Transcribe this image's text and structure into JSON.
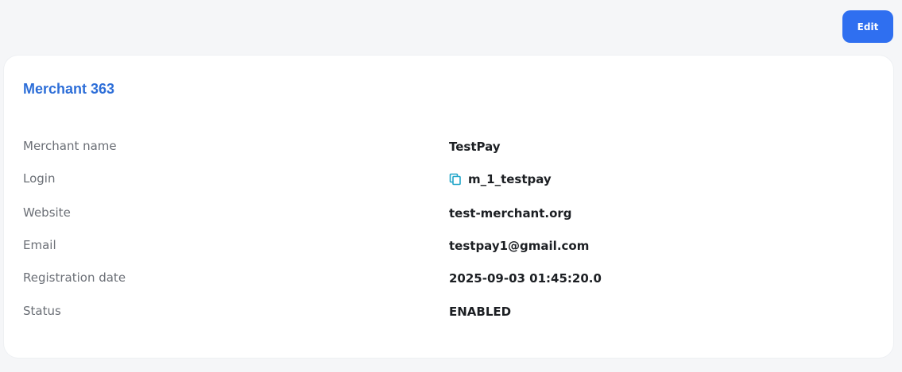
{
  "toolbar": {
    "edit_label": "Edit"
  },
  "card": {
    "title": "Merchant 363",
    "fields": [
      {
        "label": "Merchant name",
        "value": "TestPay"
      },
      {
        "label": "Login",
        "value": "m_1_testpay",
        "icon": "copy-icon"
      },
      {
        "label": "Website",
        "value": "test-merchant.org"
      },
      {
        "label": "Email",
        "value": "testpay1@gmail.com"
      },
      {
        "label": "Registration date",
        "value": "2025-09-03 01:45:20.0"
      },
      {
        "label": "Status",
        "value": "ENABLED"
      }
    ]
  },
  "colors": {
    "accent": "#2f6ff0",
    "title": "#2d6ed8",
    "copy_icon": "#22a6c9"
  }
}
